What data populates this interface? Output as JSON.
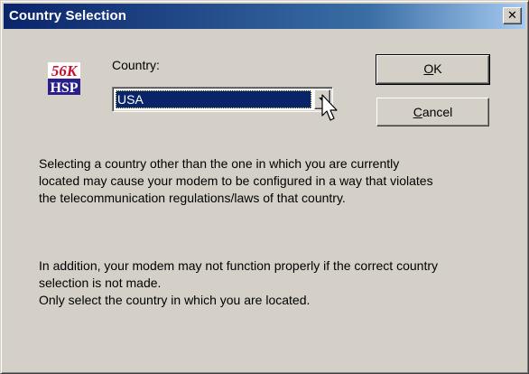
{
  "window": {
    "title": "Country Selection",
    "close_glyph": "✕"
  },
  "logo": {
    "line1": "56K",
    "line2": "HSP",
    "colors": {
      "top": "#c8102e",
      "bottom": "#2a1e8a"
    }
  },
  "form": {
    "country_label": "Country:",
    "country_value": "USA"
  },
  "buttons": {
    "ok": {
      "mnemonic": "O",
      "rest": "K"
    },
    "cancel": {
      "mnemonic": "C",
      "rest": "ancel"
    }
  },
  "messages": {
    "warning_lines": [
      "Selecting a country other than the one in which you are currently",
      "located may cause your modem to be configured in a way that violates",
      "the telecommunication regulations/laws of that country."
    ],
    "addition_lines": [
      "In addition, your modem may not function properly if the correct country",
      "selection is not made."
    ],
    "instruction": "Only select the country in which you are located."
  },
  "colors": {
    "face": "#d4d0c8",
    "title_start": "#0a246a",
    "title_end": "#a6caf0",
    "selection": "#0a246a"
  }
}
